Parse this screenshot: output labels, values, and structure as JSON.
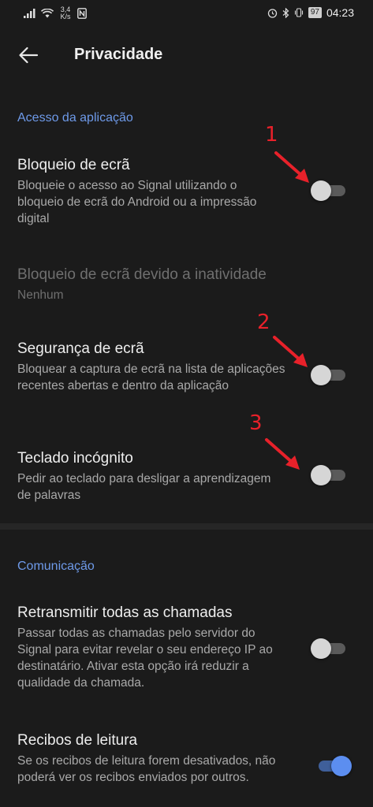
{
  "status_bar": {
    "net_speed_top": "3,4",
    "net_speed_bottom": "K/s",
    "battery": "97",
    "time": "04:23"
  },
  "toolbar": {
    "title": "Privacidade",
    "back_icon": "arrow-left-icon"
  },
  "sections": {
    "app_access": {
      "header": "Acesso da aplicação",
      "screen_lock": {
        "title": "Bloqueio de ecrã",
        "summary": "Bloqueie o acesso ao Signal utilizando o bloqueio de ecrã do Android ou a impressão digital",
        "enabled": false
      },
      "inactivity_lock": {
        "title": "Bloqueio de ecrã devido a inatividade",
        "summary": "Nenhum"
      },
      "screen_security": {
        "title": "Segurança de ecrã",
        "summary": "Bloquear a captura de ecrã na lista de aplicações recentes abertas e dentro da aplicação",
        "enabled": false
      },
      "incognito_keyboard": {
        "title": "Teclado incógnito",
        "summary": "Pedir ao teclado para desligar a aprendizagem de palavras",
        "enabled": false
      }
    },
    "communication": {
      "header": "Comunicação",
      "relay_calls": {
        "title": "Retransmitir todas as chamadas",
        "summary": "Passar todas as chamadas pelo servidor do Signal para evitar revelar o seu endereço IP ao destinatário. Ativar esta opção irá reduzir a qualidade da chamada.",
        "enabled": false
      },
      "read_receipts": {
        "title": "Recibos de leitura",
        "summary": "Se os recibos de leitura forem desativados, não poderá ver os recibos enviados por outros.",
        "enabled": true
      }
    }
  },
  "annotations": [
    "1",
    "2",
    "3"
  ],
  "colors": {
    "background": "#1b1b1b",
    "accent": "#6e9ae9",
    "annotation": "#e8212a"
  }
}
